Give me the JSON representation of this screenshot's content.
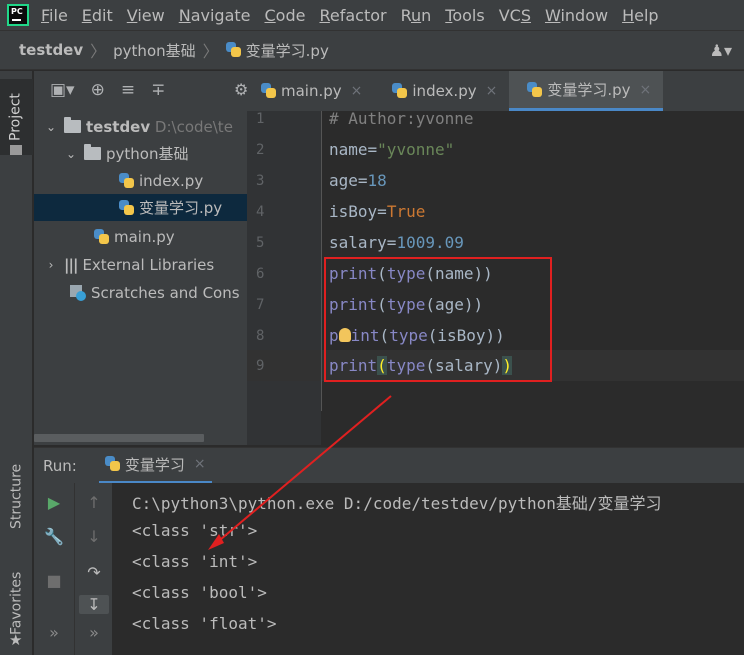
{
  "menubar": {
    "logo_text": "PC",
    "items": [
      "File",
      "Edit",
      "View",
      "Navigate",
      "Code",
      "Refactor",
      "Run",
      "Tools",
      "VCS",
      "Window",
      "Help"
    ],
    "mnemonics": [
      "F",
      "E",
      "V",
      "N",
      "C",
      "R",
      "u",
      "T",
      "S",
      "W",
      "H"
    ]
  },
  "breadcrumb": {
    "project": "testdev",
    "folder": "python基础",
    "file": "变量学习.py"
  },
  "left_strip": {
    "project_tab": "Project",
    "structure_tab": "Structure",
    "favorites_tab": "Favorites"
  },
  "project_tree": {
    "root_name": "testdev",
    "root_path": "D:\\code\\te",
    "folder": "python基础",
    "files": [
      "index.py",
      "变量学习.py"
    ],
    "main_file": "main.py",
    "external_libraries": "External Libraries",
    "scratches": "Scratches and Cons"
  },
  "editor_tabs": [
    {
      "label": "main.py",
      "close": "×"
    },
    {
      "label": "index.py",
      "close": "×"
    },
    {
      "label": "变量学习.py",
      "close": "×"
    }
  ],
  "code_lines": [
    {
      "n": "1",
      "text": "# Author:yvonne"
    },
    {
      "n": "2",
      "name": "name",
      "op": "=",
      "value": "\"yvonne\""
    },
    {
      "n": "3",
      "name": "age",
      "op": "=",
      "value": "18"
    },
    {
      "n": "4",
      "name": "isBoy",
      "op": "=",
      "value": "True"
    },
    {
      "n": "5",
      "name": "salary",
      "op": "=",
      "value": "1009.09"
    },
    {
      "n": "6",
      "fn": "print",
      "inner_fn": "type",
      "arg": "name"
    },
    {
      "n": "7",
      "fn": "print",
      "inner_fn": "type",
      "arg": "age"
    },
    {
      "n": "8",
      "fn_a": "p",
      "fn_b": "int",
      "inner_fn": "type",
      "arg": "isBoy"
    },
    {
      "n": "9",
      "fn": "print",
      "inner_fn": "type",
      "arg": "salary"
    }
  ],
  "run_panel": {
    "label": "Run:",
    "tab_label": "变量学习",
    "close": "×",
    "command": "C:\\python3\\python.exe D:/code/testdev/python基础/变量学习",
    "outputs": [
      "<class 'str'>",
      "<class 'int'>",
      "<class 'bool'>",
      "<class 'float'>"
    ]
  },
  "colors": {
    "annotation_box": "#e02020",
    "arrow": "#e02020",
    "active_tab_underline": "#4a88c7"
  }
}
